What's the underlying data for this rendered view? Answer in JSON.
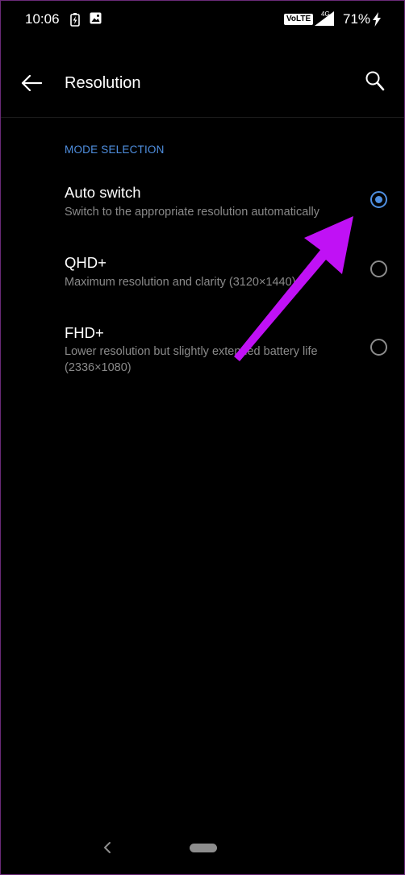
{
  "status_bar": {
    "time": "10:06",
    "volte": "VoLTE",
    "network": "4G",
    "battery_percent": "71%"
  },
  "app_bar": {
    "title": "Resolution"
  },
  "section": {
    "header": "MODE SELECTION"
  },
  "options": [
    {
      "title": "Auto switch",
      "description": "Switch to the appropriate resolution automatically",
      "selected": true
    },
    {
      "title": "QHD+",
      "description": "Maximum resolution and clarity (3120×1440)",
      "selected": false
    },
    {
      "title": "FHD+",
      "description": "Lower resolution but slightly extended battery life (2336×1080)",
      "selected": false
    }
  ],
  "colors": {
    "background": "#000000",
    "accent": "#4f8fe0",
    "annotation_arrow": "#c011f5",
    "secondary_text": "#8a8a8a"
  }
}
